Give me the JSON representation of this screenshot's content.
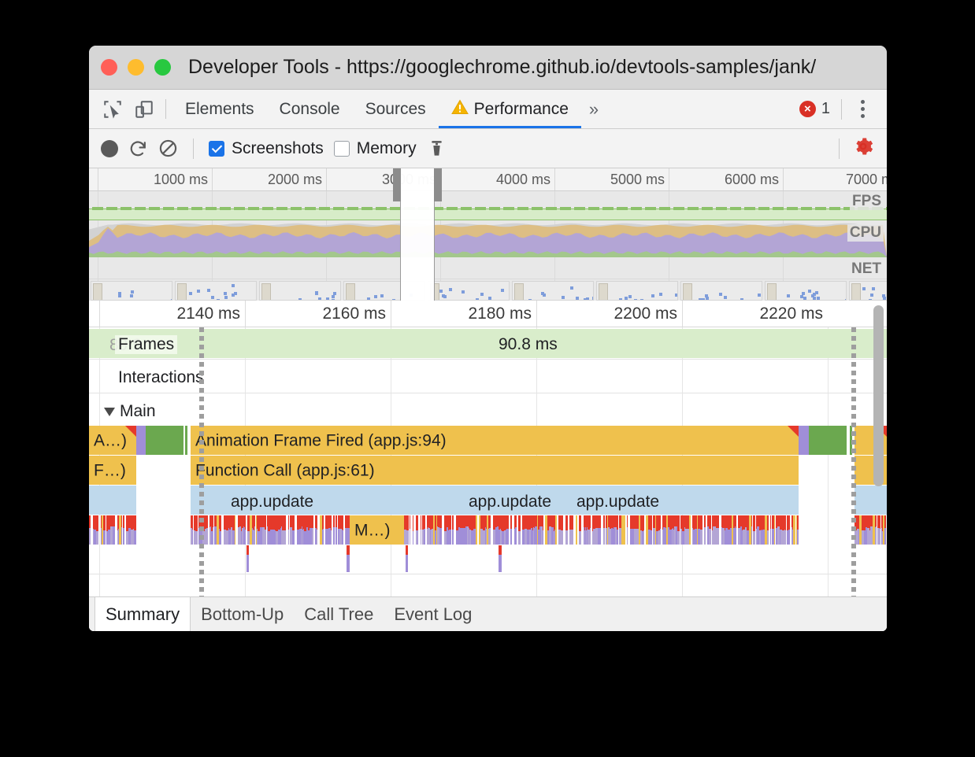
{
  "window": {
    "title": "Developer Tools - https://googlechrome.github.io/devtools-samples/jank/",
    "traffic_lights": [
      "close",
      "minimize",
      "maximize"
    ]
  },
  "tabstrip": {
    "icons": [
      "inspect-element-icon",
      "device-toolbar-icon"
    ],
    "tabs": [
      {
        "label": "Elements",
        "active": false,
        "warning": false
      },
      {
        "label": "Console",
        "active": false,
        "warning": false
      },
      {
        "label": "Sources",
        "active": false,
        "warning": false
      },
      {
        "label": "Performance",
        "active": true,
        "warning": true
      }
    ],
    "overflow": "»",
    "error_count": "1",
    "error_glyph": "×",
    "menu": "more-options"
  },
  "toolbar": {
    "record_label": "record",
    "reload_label": "reload-and-record",
    "clear_label": "clear",
    "screenshots": {
      "label": "Screenshots",
      "checked": true
    },
    "memory": {
      "label": "Memory",
      "checked": false
    },
    "trash_label": "collect-garbage",
    "settings_label": "capture-settings",
    "settings_color": "#d93025"
  },
  "overview": {
    "ruler_ticks": [
      "1000 ms",
      "2000 ms",
      "3000 ms",
      "4000 ms",
      "5000 ms",
      "6000 ms",
      "7000 m"
    ],
    "track_labels": [
      "FPS",
      "CPU",
      "NET"
    ],
    "colors": {
      "long_task_band": "#e96a62",
      "fps_band": "#d7ecc8",
      "fps_stroke": "#8cc26a",
      "cpu_scripting": "#ddbe84",
      "cpu_rendering": "#b3a5d5",
      "cpu_painting": "#a3c78c",
      "filmstrip_dot": "#7e9ddb"
    },
    "selection": {
      "start_pct": 39.0,
      "end_pct": 43.3
    }
  },
  "flame": {
    "ruler_ticks": [
      "2140 ms",
      "2160 ms",
      "2180 ms",
      "2200 ms",
      "2220 ms"
    ],
    "tracks": [
      {
        "name": "Frames",
        "label": "Frames",
        "value": "90.8 ms",
        "hidden_label": "89.9"
      },
      {
        "name": "Interactions",
        "label": "Interactions"
      },
      {
        "name": "Main",
        "label": "Main",
        "expanded": true,
        "arrow": "▼"
      }
    ],
    "events": {
      "animation_frame_left": "A…)",
      "animation_frame": "Animation Frame Fired (app.js:94)",
      "function_call_left": "F…)",
      "function_call": "Function Call (app.js:61)",
      "app_update": [
        "app.update",
        "app.update",
        "app.update"
      ],
      "minor_gc": "M…)"
    },
    "colors": {
      "scripting": "#efc14d",
      "function": "#bfd9ec",
      "painting": "#6ba84f",
      "rendering": "#a08ed8",
      "warning": "#e5392a",
      "frame_band": "#d9edcb"
    }
  },
  "bottom_tabs": [
    {
      "label": "Summary",
      "active": true
    },
    {
      "label": "Bottom-Up",
      "active": false
    },
    {
      "label": "Call Tree",
      "active": false
    },
    {
      "label": "Event Log",
      "active": false
    }
  ]
}
